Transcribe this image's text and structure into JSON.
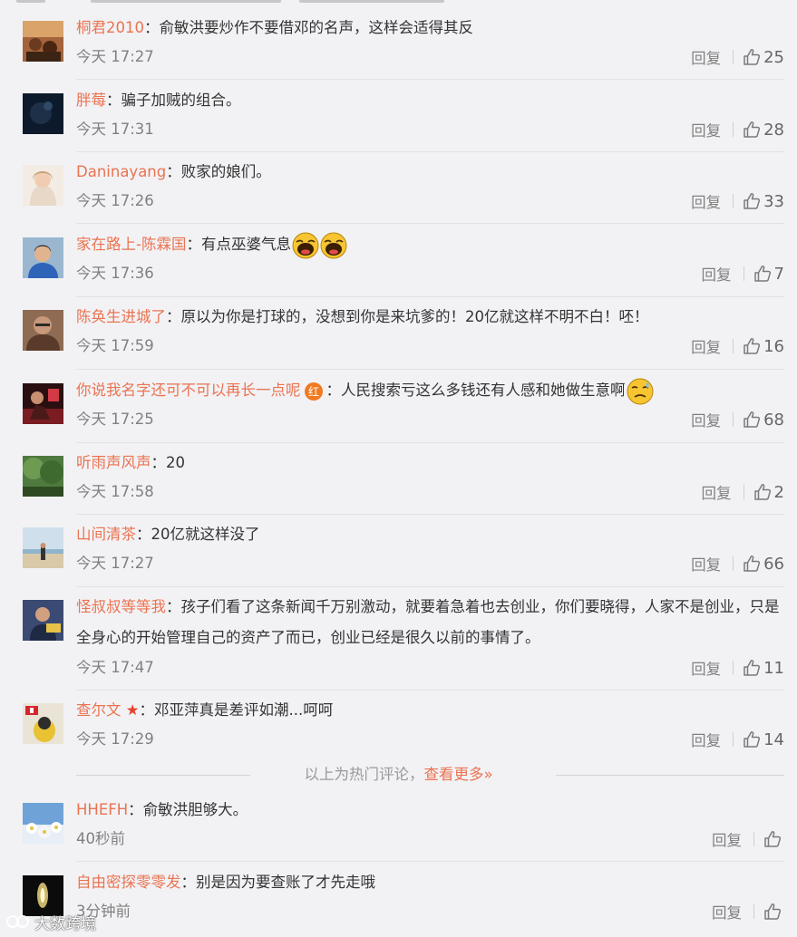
{
  "hot_comments": [
    {
      "username": "桐君2010",
      "text": "俞敏洪要炒作不要借邓的名声，这样会适得其反",
      "time": "今天 17:27",
      "reply": "回复",
      "likes": "25"
    },
    {
      "username": "胖莓",
      "text": "骗子加贼的组合。",
      "time": "今天 17:31",
      "reply": "回复",
      "likes": "28"
    },
    {
      "username": "Daninayang",
      "text": "败家的娘们。",
      "time": "今天 17:26",
      "reply": "回复",
      "likes": "33"
    },
    {
      "username": "家在路上-陈霖国",
      "text": "有点巫婆气息",
      "time": "今天 17:36",
      "reply": "回复",
      "likes": "7",
      "emoticons": [
        "laugh-emoji",
        "laugh-emoji"
      ]
    },
    {
      "username": "陈奂生进城了",
      "text": "原以为你是打球的，没想到你是来坑爹的！20亿就这样不明不白！呸！",
      "time": "今天 17:59",
      "reply": "回复",
      "likes": "16"
    },
    {
      "username": "你说我名字还可不可以再长一点呢",
      "badge": "红",
      "text": "人民搜索亏这么多钱还有人感和她做生意啊",
      "time": "今天 17:25",
      "reply": "回复",
      "likes": "68",
      "emoticons": [
        "sweat-emoji"
      ]
    },
    {
      "username": "听雨声风声",
      "text": "20",
      "time": "今天 17:58",
      "reply": "回复",
      "likes": "2"
    },
    {
      "username": "山间清茶",
      "text": "20亿就这样没了",
      "time": "今天 17:27",
      "reply": "回复",
      "likes": "66"
    },
    {
      "username": "怪叔叔等等我",
      "text": "孩子们看了这条新闻千万别激动，就要着急着也去创业，你们要晓得，人家不是创业，只是全身心的开始管理自己的资产了而已，创业已经是很久以前的事情了。",
      "time": "今天 17:47",
      "reply": "回复",
      "likes": "11"
    },
    {
      "username": "查尔文",
      "star": "★",
      "text": "邓亚萍真是差评如潮...呵呵",
      "time": "今天 17:29",
      "reply": "回复",
      "likes": "14"
    }
  ],
  "hot_footer": {
    "text": "以上为热门评论，",
    "more": "查看更多»"
  },
  "latest_comments": [
    {
      "username": "HHEFH",
      "text": "俞敏洪胆够大。",
      "time": "40秒前",
      "reply": "回复",
      "likes": ""
    },
    {
      "username": "自由密探零零发",
      "text": "别是因为要查账了才先走哦",
      "time": "3分钟前",
      "reply": "回复",
      "likes": ""
    }
  ],
  "watermark": "大数跨境",
  "colors": {
    "username": "#eb7350",
    "text": "#333333",
    "meta": "#808080",
    "background": "#f2f2f5"
  }
}
